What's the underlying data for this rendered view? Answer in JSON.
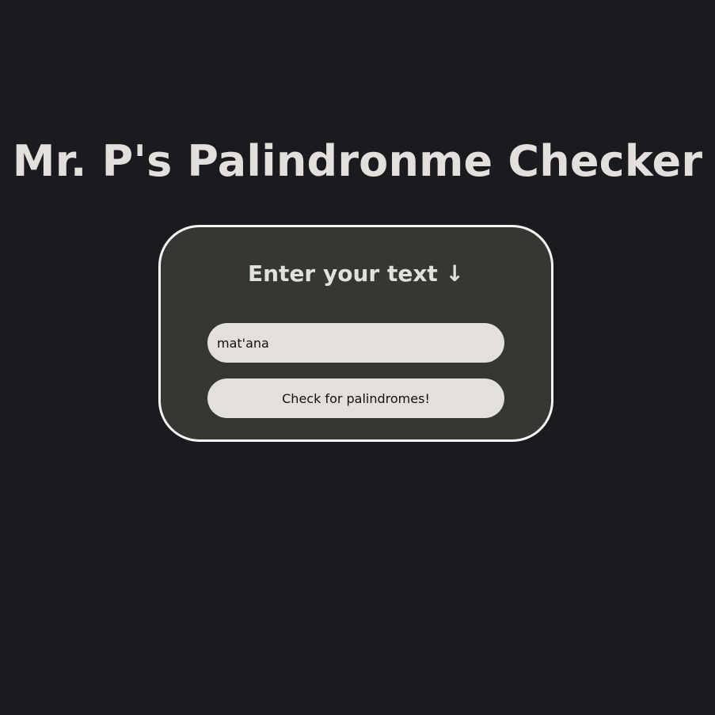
{
  "page": {
    "title": "Mr. P's Palindronme Checker"
  },
  "card": {
    "heading": "Enter your text ↓",
    "input_value": "mat'ana",
    "button_label": "Check for palindromes!"
  },
  "colors": {
    "background": "#1b1a1f",
    "card_background": "#353832",
    "card_border": "#f4f4f4",
    "text_light": "#e2dfdc",
    "control_background": "#e2dfdc"
  }
}
